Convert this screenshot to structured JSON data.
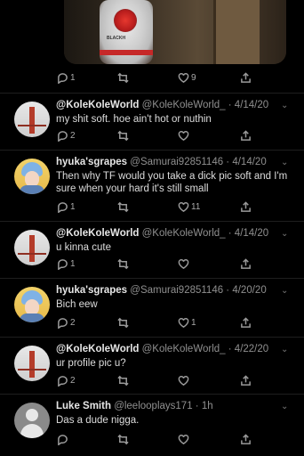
{
  "top_tweet": {
    "media_alt_icon": "photo-thumbnail",
    "shirt_text": "BLACKH",
    "reply_count": "1",
    "like_count": "9"
  },
  "tweets": [
    {
      "display_name": "@KoleKoleWorld",
      "handle": "@KoleKoleWorld_",
      "date": "4/14/20",
      "text": "my shit soft. hoe ain't hot or nuthin",
      "reply_count": "2",
      "retweet_count": "",
      "like_count": "",
      "avatar": "golden-gate-bridge"
    },
    {
      "display_name": "hyuka'sgrapes",
      "handle": "@Samurai92851146",
      "date": "4/14/20",
      "text": "Then why TF would you take a dick pic soft and I'm sure when your hard it's still small",
      "reply_count": "1",
      "retweet_count": "",
      "like_count": "11",
      "avatar": "anime-blue-hair"
    },
    {
      "display_name": "@KoleKoleWorld",
      "handle": "@KoleKoleWorld_",
      "date": "4/14/20",
      "text": "u kinna cute",
      "reply_count": "1",
      "retweet_count": "",
      "like_count": "",
      "avatar": "golden-gate-bridge"
    },
    {
      "display_name": "hyuka'sgrapes",
      "handle": "@Samurai92851146",
      "date": "4/20/20",
      "text": "Bich eew",
      "reply_count": "2",
      "retweet_count": "",
      "like_count": "1",
      "avatar": "anime-blue-hair"
    },
    {
      "display_name": "@KoleKoleWorld",
      "handle": "@KoleKoleWorld_",
      "date": "4/22/20",
      "text": "ur profile pic u?",
      "reply_count": "2",
      "retweet_count": "",
      "like_count": "",
      "avatar": "golden-gate-bridge"
    },
    {
      "display_name": "Luke Smith",
      "handle": "@leelooplays171",
      "date": "1h",
      "text": "Das a dude nigga.",
      "reply_count": "",
      "retweet_count": "",
      "like_count": "",
      "avatar": "default-egg"
    }
  ],
  "separator": " · ",
  "colors": {
    "background": "#000000",
    "text": "#d9d9d9",
    "muted": "#8f8f8f",
    "icon": "#9a9a9a"
  }
}
